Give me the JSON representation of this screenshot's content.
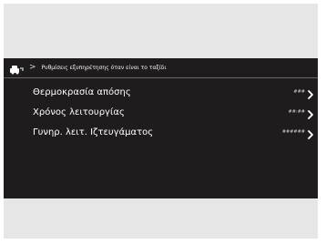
{
  "breadcrumb": {
    "icon": "settings-gear-icon",
    "separator": ">",
    "text": "Ρυθμίσεις εξυπηρέτησης όταν είναι το ταξίδι"
  },
  "menu": {
    "items": [
      {
        "label": "Θερμοκρασία απόσης",
        "value": "### ",
        "chevron_icon": "chevron-right-icon"
      },
      {
        "label": "Χρόνος λειτουργίας",
        "value": "##:##",
        "chevron_icon": "chevron-right-icon"
      },
      {
        "label": "Γυνηρ. λειτ. Ιζτευγάματος",
        "value": "######",
        "chevron_icon": "chevron-right-icon"
      }
    ]
  },
  "colors": {
    "screen_background": "#1f1c1d",
    "frame_gray": "#e6e6e6",
    "text_primary": "#ffffff"
  }
}
